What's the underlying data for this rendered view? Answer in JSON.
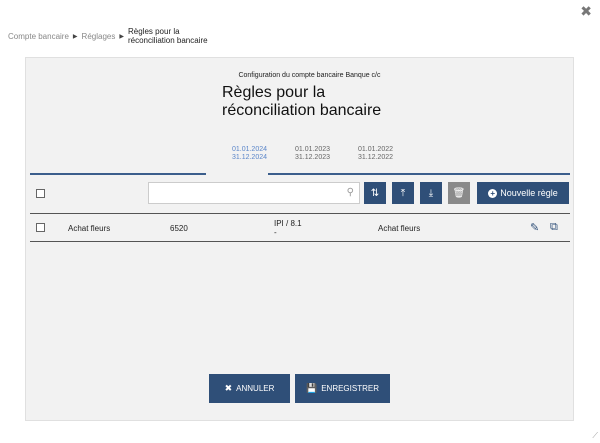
{
  "breadcrumb": {
    "items": [
      "Compte bancaire",
      "Réglages"
    ],
    "current_line1": "Règles pour la",
    "current_line2": "réconciliation bancaire"
  },
  "header": {
    "subtitle": "Configuration du compte bancaire Banque c/c",
    "title_line1": "Règles pour la",
    "title_line2": "réconciliation bancaire"
  },
  "periods": [
    {
      "from": "01.01.2024",
      "to": "31.12.2024",
      "active": true
    },
    {
      "from": "01.01.2023",
      "to": "31.12.2023",
      "active": false
    },
    {
      "from": "01.01.2022",
      "to": "31.12.2022",
      "active": false
    }
  ],
  "search": {
    "value": "",
    "placeholder": ""
  },
  "toolbar": {
    "new_rule_label": "Nouvelle règle"
  },
  "rules": [
    {
      "name": "Achat fleurs",
      "account": "6520",
      "vat_line1": "IPI / 8.1",
      "vat_line2": "-",
      "description": "Achat fleurs"
    }
  ],
  "footer": {
    "cancel_label": "ANNULER",
    "save_label": "ENREGISTRER"
  },
  "colors": {
    "primary": "#2f4f78",
    "active_period": "#5b86c9",
    "panel_bg": "#f2f2f2"
  }
}
